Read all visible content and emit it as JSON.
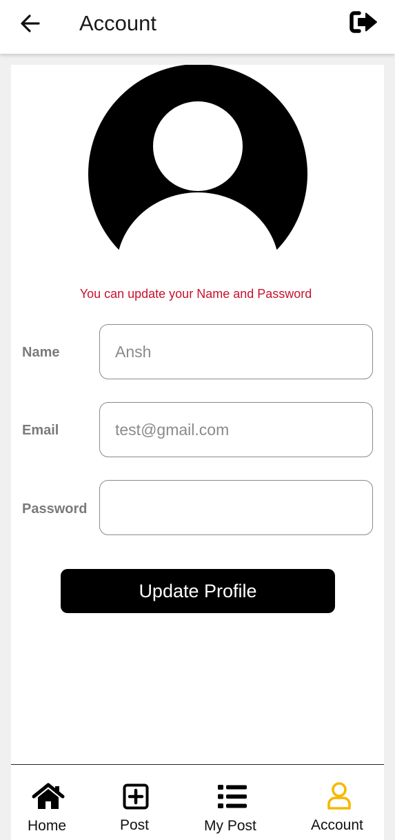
{
  "header": {
    "title": "Account"
  },
  "profile": {
    "hint": "You can update your Name and Password"
  },
  "form": {
    "name_label": "Name",
    "name_value": "Ansh",
    "email_label": "Email",
    "email_value": "test@gmail.com",
    "password_label": "Password",
    "password_value": "",
    "submit_label": "Update Profile"
  },
  "bottom_nav": {
    "items": [
      {
        "label": "Home",
        "icon": "home-icon"
      },
      {
        "label": "Post",
        "icon": "plus-square-icon"
      },
      {
        "label": "My Post",
        "icon": "list-icon"
      },
      {
        "label": "Account",
        "icon": "user-icon"
      }
    ],
    "active": "Account"
  },
  "colors": {
    "accent": "#f5b800",
    "hint": "#c8102e",
    "button": "#000000"
  }
}
